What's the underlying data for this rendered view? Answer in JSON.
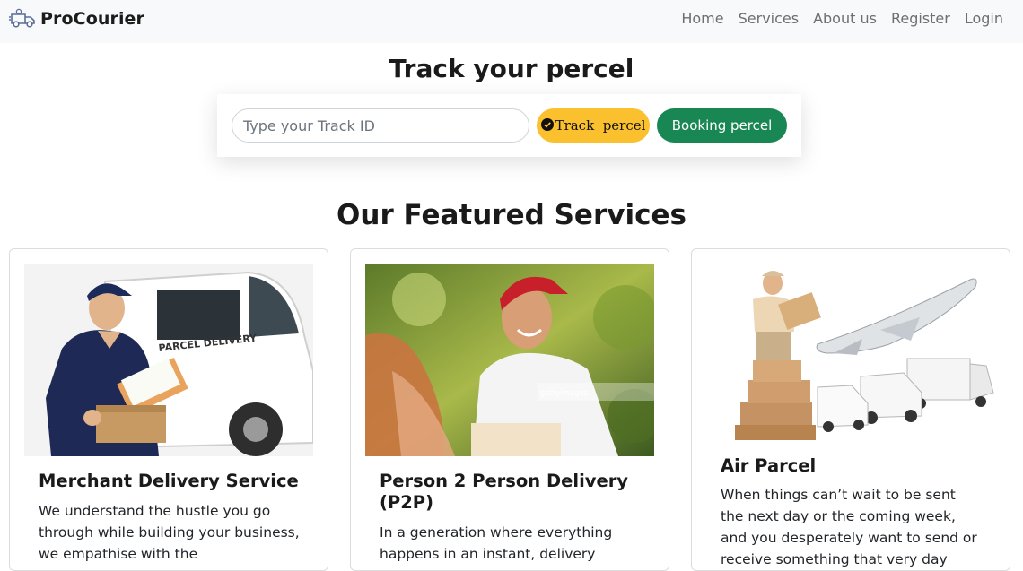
{
  "navbar": {
    "brand": "ProCourier",
    "links": [
      "Home",
      "Services",
      "About us",
      "Register",
      "Login"
    ]
  },
  "track": {
    "title": "Track your percel",
    "input_placeholder": "Type your Track ID",
    "track_button": "Track  percel",
    "booking_button": "Booking percel"
  },
  "services": {
    "title": "Our Featured Services",
    "cards": [
      {
        "title": "Merchant Delivery Service",
        "text": "We understand the hustle you go through while building your business, we empathise with the"
      },
      {
        "title": "Person 2 Person Delivery (P2P)",
        "text": "In a generation where everything happens in an instant, delivery"
      },
      {
        "title": "Air Parcel",
        "text": "When things can’t wait to be sent the next day or the coming week, and you desperately want to send or receive something that very day"
      }
    ],
    "image_watermark": "gettyimages"
  },
  "colors": {
    "navbar_bg": "#f8f9fa",
    "track_button": "#fbc02d",
    "booking_button": "#198754"
  }
}
